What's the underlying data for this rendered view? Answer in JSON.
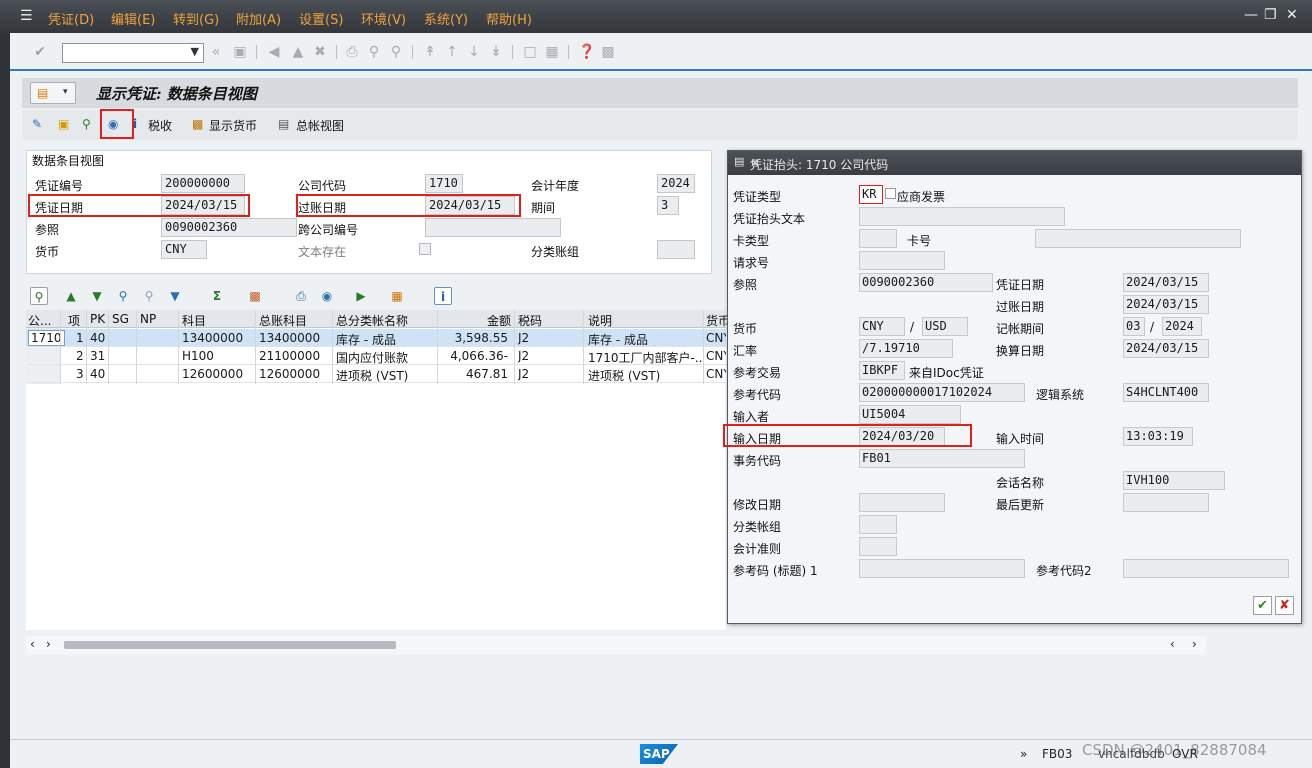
{
  "menubar": {
    "items": [
      "凭证(D)",
      "编辑(E)",
      "转到(G)",
      "附加(A)",
      "设置(S)",
      "环境(V)",
      "系统(Y)",
      "帮助(H)"
    ]
  },
  "title": "显示凭证: 数据条目视图",
  "app_toolbar": {
    "tax": "税收",
    "display_currency": "显示货币",
    "general_ledger_view": "总帐视图"
  },
  "header_panel": {
    "section_title": "数据条目视图",
    "doc_number_label": "凭证编号",
    "doc_number": "200000000",
    "company_code_label": "公司代码",
    "company_code": "1710",
    "fiscal_year_label": "会计年度",
    "fiscal_year": "2024",
    "doc_date_label": "凭证日期",
    "doc_date": "2024/03/15",
    "posting_date_label": "过账日期",
    "posting_date": "2024/03/15",
    "period_label": "期间",
    "period": "3",
    "reference_label": "参照",
    "reference": "0090002360",
    "cross_cc_label": "跨公司编号",
    "currency_label": "货币",
    "currency": "CNY",
    "text_exists_label": "文本存在",
    "ledger_group_label": "分类账组"
  },
  "grid": {
    "headers": [
      "公...",
      "项",
      "PK",
      "SG",
      "NP",
      "科目",
      "总账科目",
      "总分类帐名称",
      "金额",
      "税码",
      "说明",
      "货币"
    ],
    "rows": [
      {
        "cc": "1710",
        "item": "1",
        "pk": "40",
        "account": "13400000",
        "gl": "13400000",
        "gl_name": "库存 - 成品",
        "amount": "3,598.55",
        "tax": "J2",
        "text": "库存 - 成品",
        "cur": "CNY"
      },
      {
        "cc": "",
        "item": "2",
        "pk": "31",
        "account": "H100",
        "gl": "21100000",
        "gl_name": "国内应付账款",
        "amount": "4,066.36-",
        "tax": "J2",
        "text": "1710工厂内部客户-...",
        "cur": "CNY"
      },
      {
        "cc": "",
        "item": "3",
        "pk": "40",
        "account": "12600000",
        "gl": "12600000",
        "gl_name": "进项税 (VST)",
        "amount": "467.81",
        "tax": "J2",
        "text": "进项税 (VST)",
        "cur": "CNY"
      }
    ]
  },
  "popup": {
    "title": "凭证抬头: 1710 公司代码",
    "doc_type_label": "凭证类型",
    "doc_type": "KR",
    "doc_type_desc": "应商发票",
    "header_text_label": "凭证抬头文本",
    "card_type_label": "卡类型",
    "card_no_label": "卡号",
    "request_no_label": "请求号",
    "reference_label": "参照",
    "reference": "0090002360",
    "doc_date_label": "凭证日期",
    "doc_date": "2024/03/15",
    "posting_date_label": "过账日期",
    "posting_date": "2024/03/15",
    "currency_label": "货币",
    "currency": "CNY",
    "currency_sep": "/",
    "currency2": "USD",
    "period_label": "记帐期间",
    "period": "03",
    "period_sep": "/",
    "period_year": "2024",
    "rate_label": "汇率",
    "rate": "/7.19710",
    "translation_date_label": "换算日期",
    "translation_date": "2024/03/15",
    "ref_txn_label": "参考交易",
    "ref_txn": "IBKPF",
    "ref_txn_desc": "来自IDoc凭证",
    "ref_key_label": "参考代码",
    "ref_key": "020000000017102024",
    "logical_system_label": "逻辑系统",
    "logical_system": "S4HCLNT400",
    "entered_by_label": "输入者",
    "entered_by": "UI5004",
    "entry_date_label": "输入日期",
    "entry_date": "2024/03/20",
    "entry_time_label": "输入时间",
    "entry_time": "13:03:19",
    "tcode_label": "事务代码",
    "tcode": "FB01",
    "session_label": "会话名称",
    "session": "IVH100",
    "changed_on_label": "修改日期",
    "last_update_label": "最后更新",
    "ledger_group_label": "分类帐组",
    "acct_principle_label": "会计准则",
    "ref_key1_label": "参考码 (标题) 1",
    "ref_key2_label": "参考代码2"
  },
  "statusbar": {
    "arrows": "»",
    "tcode": "FB03",
    "server": "vhcalfdbdb",
    "mode": "OVR",
    "watermark": "CSDN @2401_82887084"
  },
  "colors": {
    "menu_text": "#f2a33a",
    "highlight": "#e0201a",
    "selected_row": "#cfe3f7",
    "accent": "#2f7bbf"
  }
}
